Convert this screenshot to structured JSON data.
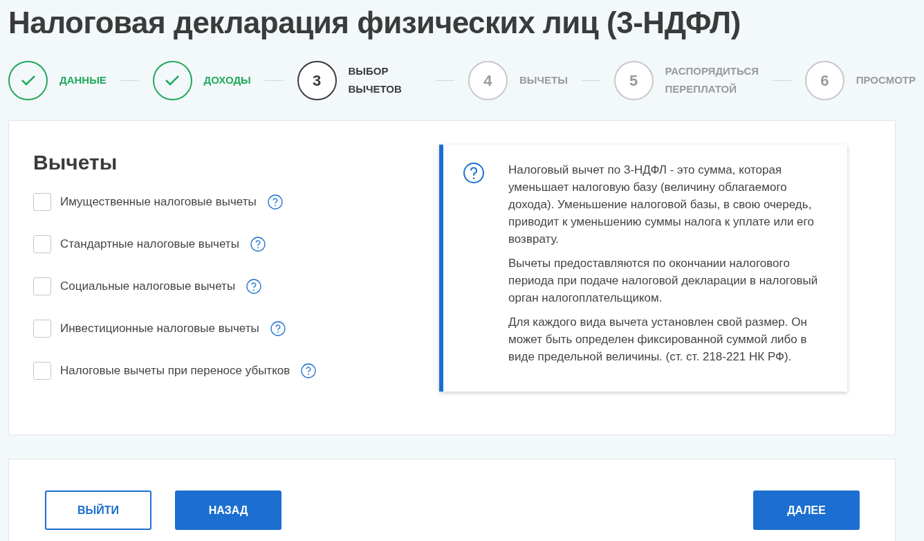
{
  "title": "Налоговая декларация физических лиц (3-НДФЛ)",
  "steps": [
    {
      "label": "ДАННЫЕ",
      "completed": true,
      "selected": false
    },
    {
      "label": "ДОХОДЫ",
      "completed": true,
      "selected": false
    },
    {
      "number": "3",
      "label": "ВЫБОР ВЫЧЕТОВ",
      "completed": false,
      "selected": true
    },
    {
      "number": "4",
      "label": "ВЫЧЕТЫ",
      "completed": false,
      "selected": false
    },
    {
      "number": "5",
      "label": "РАСПОРЯДИТЬСЯ ПЕРЕПЛАТОЙ",
      "completed": false,
      "selected": false
    },
    {
      "number": "6",
      "label": "ПРОСМОТР",
      "completed": false,
      "selected": false
    }
  ],
  "section_title": "Вычеты",
  "options": [
    {
      "label": "Имущественные налоговые вычеты",
      "checked": false
    },
    {
      "label": "Стандартные налоговые вычеты",
      "checked": false
    },
    {
      "label": "Социальные налоговые вычеты",
      "checked": false
    },
    {
      "label": "Инвестиционные налоговые вычеты",
      "checked": false
    },
    {
      "label": "Налоговые вычеты при переносе убытков",
      "checked": false
    }
  ],
  "info": {
    "paragraphs": [
      "Налоговый вычет по 3-НДФЛ - это сумма, которая уменьшает налоговую базу (величину облагаемого дохода). Уменьшение налоговой базы, в свою очередь, приводит к уменьшению суммы налога к уплате или его возврату.",
      "Вычеты предоставляются по окончании налогового периода при подаче налоговой декларации в налоговый орган налогоплательщиком.",
      "Для каждого вида вычета установлен свой размер. Он может быть определен фиксированной суммой либо в виде предельной величины. (ст. ст. 218-221 НК РФ)."
    ]
  },
  "buttons": [
    {
      "label": "ВЫЙТИ",
      "kind": "outline"
    },
    {
      "label": "НАЗАД",
      "kind": "primary"
    },
    {
      "label": "ДАЛЕЕ",
      "kind": "primary"
    }
  ]
}
